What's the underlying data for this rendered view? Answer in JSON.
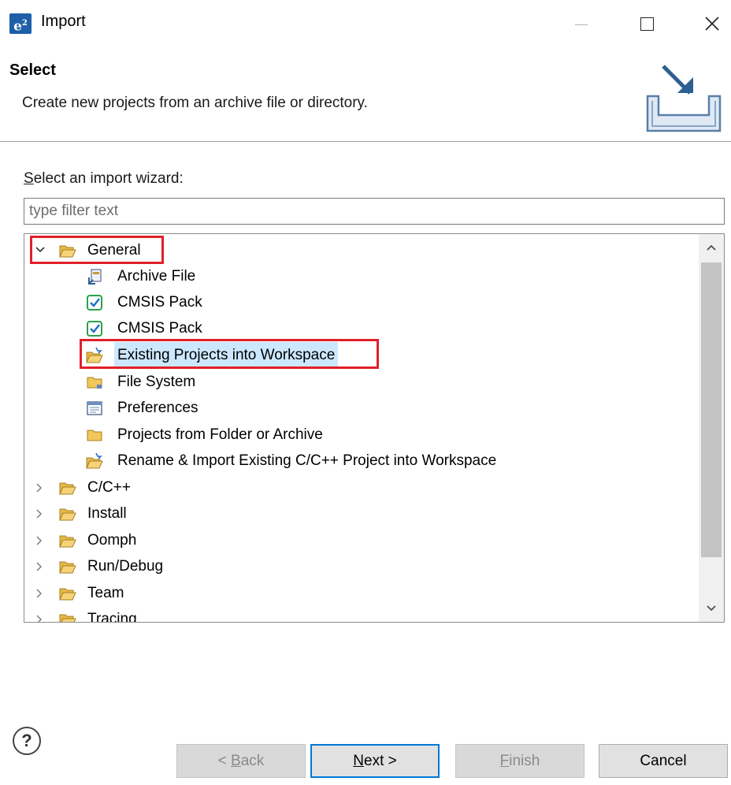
{
  "window": {
    "logo_text": "e",
    "logo_sup": "2",
    "title": "Import"
  },
  "header": {
    "title": "Select",
    "description": "Create new projects from an archive file or directory."
  },
  "wizard": {
    "label_access": "S",
    "label_rest": "elect an import wizard:",
    "filter_placeholder": "type filter text"
  },
  "tree": {
    "items": [
      {
        "label": "General",
        "expanded": true,
        "icon": "folder-open-icon"
      },
      {
        "label": "Archive File",
        "icon": "archive-file-icon"
      },
      {
        "label": "CMSIS Pack",
        "icon": "cmsis-pack-icon"
      },
      {
        "label": "CMSIS Pack",
        "icon": "cmsis-pack-icon"
      },
      {
        "label": "Existing Projects into Workspace",
        "icon": "import-project-icon",
        "selected": true
      },
      {
        "label": "File System",
        "icon": "folder-icon"
      },
      {
        "label": "Preferences",
        "icon": "preferences-icon"
      },
      {
        "label": "Projects from Folder or Archive",
        "icon": "folder-icon"
      },
      {
        "label": "Rename & Import Existing C/C++ Project into Workspace",
        "icon": "import-project-icon"
      },
      {
        "label": "C/C++",
        "expanded": false,
        "icon": "folder-open-icon"
      },
      {
        "label": "Install",
        "expanded": false,
        "icon": "folder-open-icon"
      },
      {
        "label": "Oomph",
        "expanded": false,
        "icon": "folder-open-icon"
      },
      {
        "label": "Run/Debug",
        "expanded": false,
        "icon": "folder-open-icon"
      },
      {
        "label": "Team",
        "expanded": false,
        "icon": "folder-open-icon"
      },
      {
        "label": "Tracing",
        "expanded": false,
        "icon": "folder-open-icon"
      }
    ]
  },
  "footer": {
    "help_symbol": "?",
    "back_pre": "< ",
    "back_access": "B",
    "back_rest": "ack",
    "next_access": "N",
    "next_rest": "ext >",
    "finish_access": "F",
    "finish_rest": "inish",
    "cancel": "Cancel"
  },
  "colors": {
    "selection": "#cce8ff",
    "highlight_box": "#e0202a",
    "default_button_border": "#0078d7",
    "folder": "#f2c75c"
  }
}
